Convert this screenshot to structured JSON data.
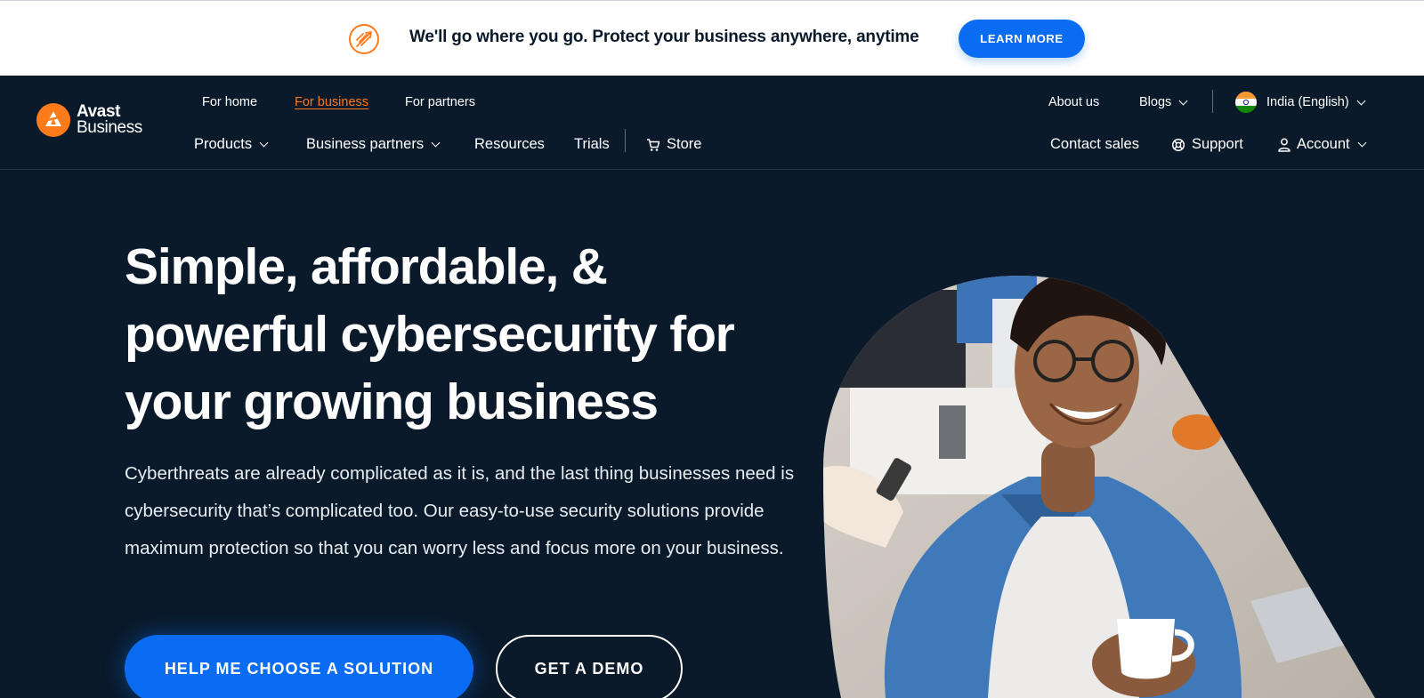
{
  "banner": {
    "text": "We'll go where you go. Protect your business anywhere, anytime",
    "button": "LEARN MORE",
    "icon": "rocket-icon"
  },
  "logo": {
    "line1": "Avast",
    "line2": "Business",
    "icon": "avast-logo-icon"
  },
  "nav": {
    "top_left": [
      "For home",
      "For business",
      "For partners"
    ],
    "active": "For business",
    "top_right": {
      "about": "About us",
      "blogs": "Blogs",
      "region": "India (English)"
    },
    "main_left": {
      "products": "Products",
      "partners": "Business partners",
      "resources": "Resources",
      "trials": "Trials",
      "store": "Store"
    },
    "main_right": {
      "contact": "Contact sales",
      "support": "Support",
      "account": "Account"
    }
  },
  "hero": {
    "title_lines": [
      "Simple, affordable, &",
      "powerful cybersecurity for",
      "your growing business"
    ],
    "description": "Cyberthreats are already complicated as it is, and the last thing businesses need is cybersecurity that’s complicated too. Our easy-to-use security solutions provide maximum protection so that you can worry less and focus more on your business.",
    "primary_button": "HELP ME CHOOSE A SOLUTION",
    "secondary_button": "GET A DEMO"
  },
  "colors": {
    "bg": "#0a1a2b",
    "accent_blue": "#0a6cf2",
    "accent_orange": "#ff7a1a"
  }
}
